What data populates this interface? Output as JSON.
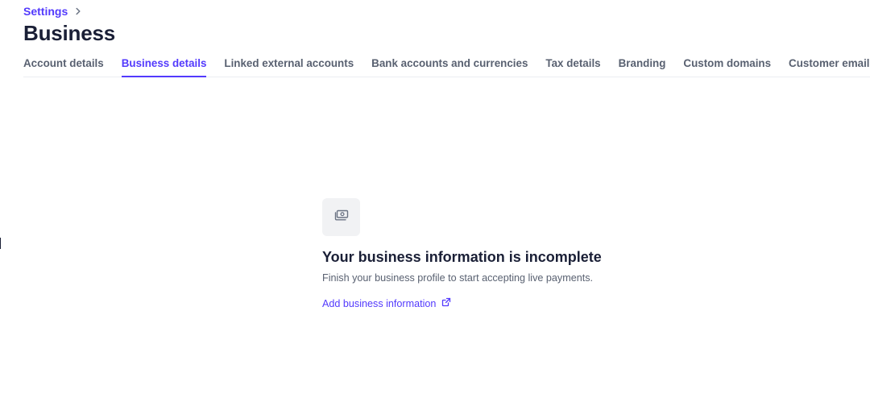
{
  "breadcrumb": {
    "parent": "Settings",
    "separator_icon": "chevron-right-icon"
  },
  "header": {
    "title": "Business"
  },
  "tabs": [
    {
      "label": "Account details",
      "active": false
    },
    {
      "label": "Business details",
      "active": true
    },
    {
      "label": "Linked external accounts",
      "active": false
    },
    {
      "label": "Bank accounts and currencies",
      "active": false
    },
    {
      "label": "Tax details",
      "active": false
    },
    {
      "label": "Branding",
      "active": false
    },
    {
      "label": "Custom domains",
      "active": false
    },
    {
      "label": "Customer emails",
      "active": false
    }
  ],
  "empty_state": {
    "icon": "cash-icon",
    "title": "Your business information is incomplete",
    "subtitle": "Finish your business profile to start accepting live payments.",
    "link_label": "Add business information",
    "link_icon": "external-link-icon"
  },
  "colors": {
    "accent": "#533afd",
    "text_primary": "#1a1f36",
    "text_secondary": "#596171",
    "divider": "#ebeef1",
    "icon_tile": "#f1f2f4"
  }
}
